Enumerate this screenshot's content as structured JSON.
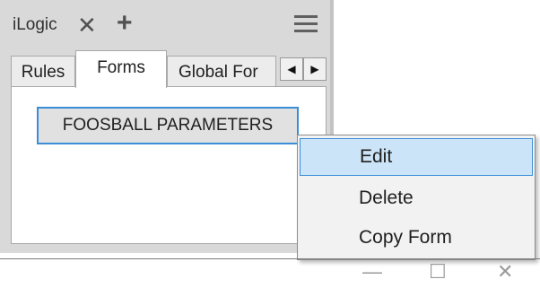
{
  "panel": {
    "title": "iLogic",
    "close_glyph": "✕",
    "add_glyph": "+",
    "menu_icon": "hamburger-icon"
  },
  "tabs": [
    {
      "label": "Rules"
    },
    {
      "label": "Forms"
    },
    {
      "label": "Global For"
    }
  ],
  "tab_scroll": {
    "left": "◀",
    "right": "▶"
  },
  "forms": {
    "button_label": "FOOSBALL PARAMETERS"
  },
  "context_menu": {
    "items": [
      {
        "label": "Edit"
      },
      {
        "label": "Delete"
      },
      {
        "label": "Copy Form"
      }
    ]
  },
  "window_controls": {
    "minimize": "—",
    "maximize": "☐",
    "close": "✕"
  },
  "colors": {
    "accent": "#3a8ed8",
    "hover": "#cce4f7",
    "panel_bg": "#d9d9d9"
  }
}
